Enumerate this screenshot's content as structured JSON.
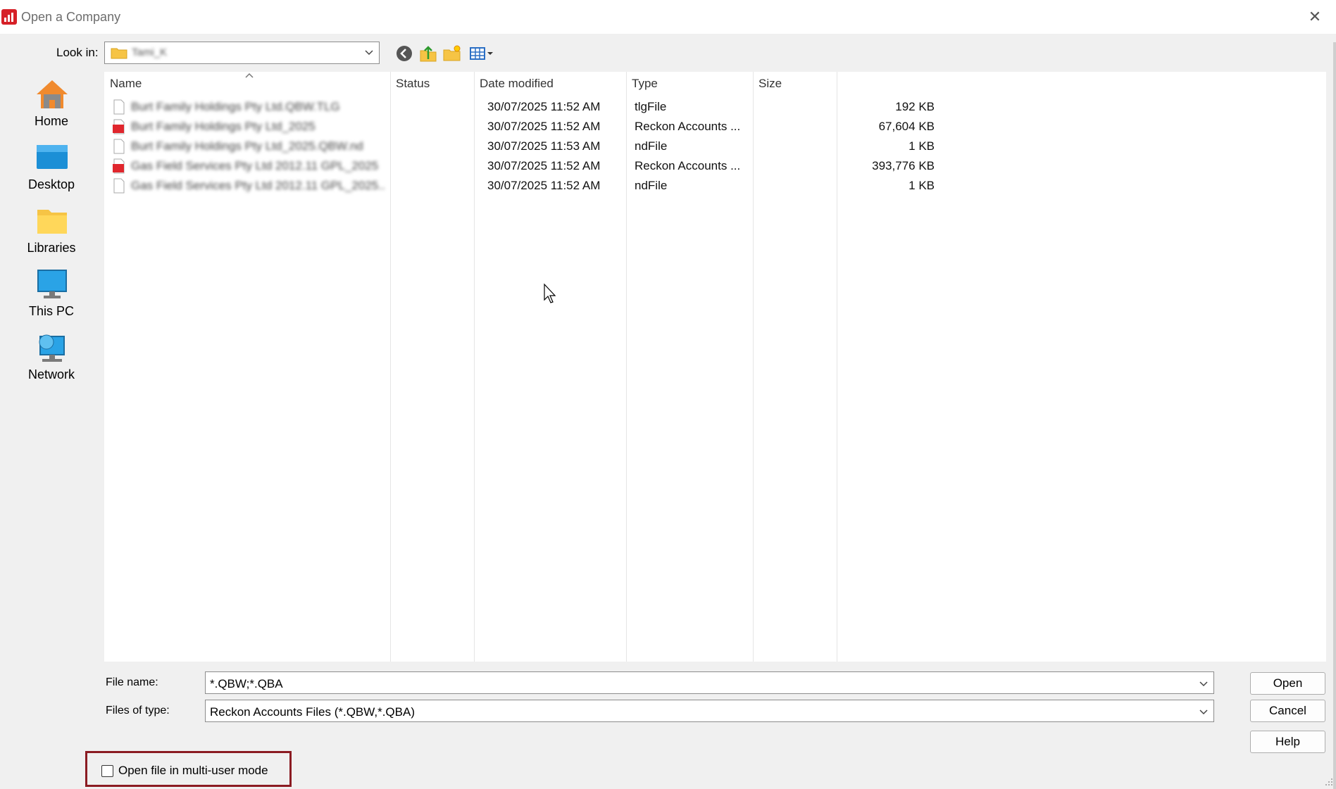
{
  "window": {
    "title": "Open a Company",
    "close_icon": "close-icon"
  },
  "toolbar": {
    "look_in_label": "Look in:",
    "look_in_value": "Tami_K",
    "buttons": [
      "back-icon",
      "up-folder-icon",
      "new-folder-icon",
      "view-menu-icon"
    ]
  },
  "places": [
    {
      "label": "Home",
      "icon": "home-icon"
    },
    {
      "label": "Desktop",
      "icon": "desktop-icon"
    },
    {
      "label": "Libraries",
      "icon": "libraries-icon"
    },
    {
      "label": "This PC",
      "icon": "this-pc-icon"
    },
    {
      "label": "Network",
      "icon": "network-icon"
    }
  ],
  "columns": {
    "name": "Name",
    "status": "Status",
    "date": "Date modified",
    "type": "Type",
    "size": "Size"
  },
  "files": [
    {
      "name": "Burt Family Holdings Pty Ltd.QBW.TLG",
      "status": "",
      "date": "30/07/2025 11:52 AM",
      "type": "tlgFile",
      "size": "192 KB",
      "icon": "generic-file-icon"
    },
    {
      "name": "Burt Family Holdings Pty Ltd_2025",
      "status": "",
      "date": "30/07/2025 11:52 AM",
      "type": "Reckon Accounts ...",
      "size": "67,604 KB",
      "icon": "reckon-file-icon"
    },
    {
      "name": "Burt Family Holdings Pty Ltd_2025.QBW.nd",
      "status": "",
      "date": "30/07/2025 11:53 AM",
      "type": "ndFile",
      "size": "1 KB",
      "icon": "generic-file-icon"
    },
    {
      "name": "Gas Field Services Pty Ltd 2012.11 GPL_2025",
      "status": "",
      "date": "30/07/2025 11:52 AM",
      "type": "Reckon Accounts ...",
      "size": "393,776 KB",
      "icon": "reckon-file-icon"
    },
    {
      "name": "Gas Field Services Pty Ltd 2012.11 GPL_2025...",
      "status": "",
      "date": "30/07/2025 11:52 AM",
      "type": "ndFile",
      "size": "1 KB",
      "icon": "generic-file-icon"
    }
  ],
  "form": {
    "file_name_label": "File name:",
    "file_name_value": "*.QBW;*.QBA",
    "files_of_type_label": "Files of type:",
    "files_of_type_value": "Reckon Accounts Files (*.QBW,*.QBA)"
  },
  "buttons": {
    "open": "Open",
    "cancel": "Cancel",
    "help": "Help"
  },
  "multi_user": {
    "label": "Open file in multi-user mode",
    "checked": false
  },
  "colors": {
    "accent_red": "#d62027",
    "highlight_border": "#8b1b22",
    "dialog_bg": "#f0f0f0"
  }
}
